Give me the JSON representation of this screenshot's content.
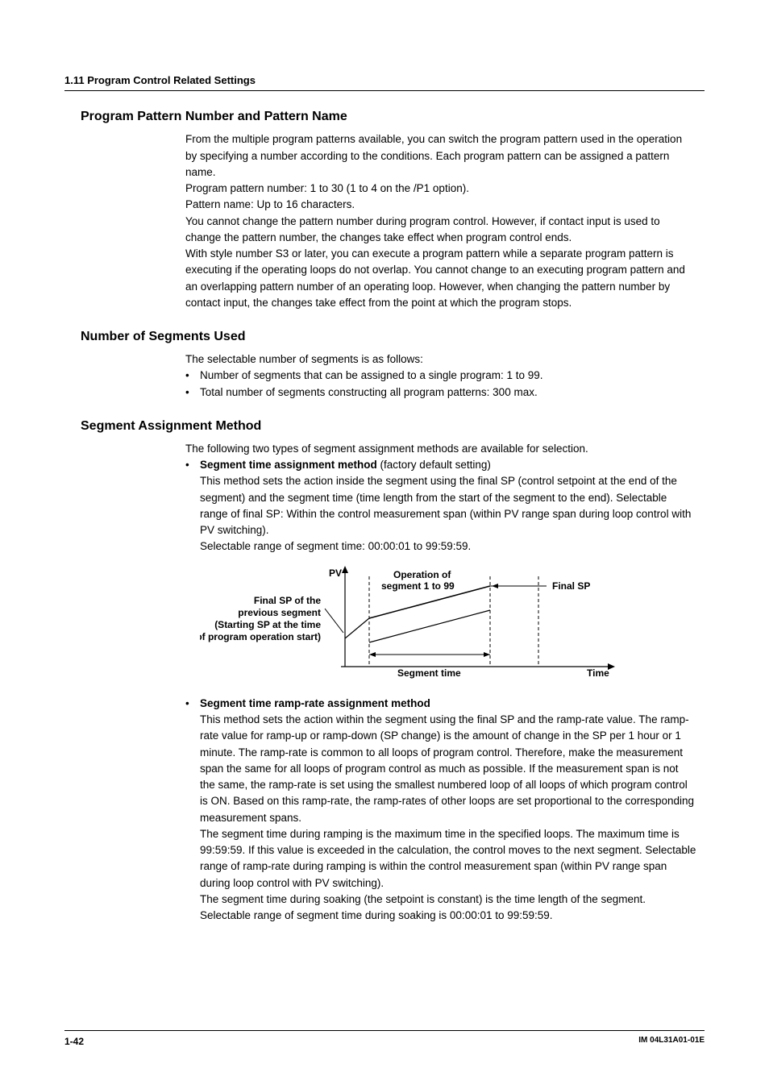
{
  "header": {
    "section": "1.11  Program Control Related Settings"
  },
  "s1": {
    "title": "Program Pattern Number and Pattern Name",
    "p1": "From the multiple program patterns available, you can switch the program pattern used in the operation by specifying a number according to the conditions.  Each program pattern can be assigned a pattern name.",
    "p2": "Program pattern number: 1 to 30 (1 to 4 on the /P1 option).",
    "p3": "Pattern name: Up to 16 characters.",
    "p4": "You cannot change the pattern number during program control.  However, if contact input is used to change the pattern number, the changes take effect when program control ends.",
    "p5": "With style number S3 or later, you can execute a program pattern while a separate program pattern is executing if the operating loops do not overlap. You cannot change to an executing program pattern and an overlapping pattern number of an operating loop. However, when changing the pattern number by contact input, the changes take effect from the point at which the program stops."
  },
  "s2": {
    "title": "Number of Segments Used",
    "p1": "The selectable number of segments is as follows:",
    "b1": "Number of segments that can be assigned to a single program: 1 to 99.",
    "b2": "Total number of segments constructing all program patterns: 300 max."
  },
  "s3": {
    "title": "Segment Assignment Method",
    "p1": "The following two types of segment assignment methods are available for selection.",
    "m1": {
      "label": "Segment time assignment method",
      "suffix": " (factory default setting)",
      "desc": "This method sets the action inside the segment using the final SP (control setpoint at the end of the segment) and the segment time (time length from the start of the segment to the end).  Selectable range of final SP: Within the control measurement span (within PV range span during loop control with PV switching).",
      "range": "Selectable range of segment time: 00:00:01 to 99:59:59."
    },
    "fig": {
      "pv": "PV",
      "opseg": "Operation of",
      "opseg2": "segment 1 to 99",
      "finalsp": "Final SP",
      "left1": "Final SP of the",
      "left2": "previous segment",
      "left3": "(Starting SP at the time",
      "left4": "of program operation start)",
      "segtime": "Segment time",
      "time": "Time"
    },
    "m2": {
      "label": "Segment time ramp-rate assignment method",
      "p1": "This method sets the action within the segment using the final SP and the ramp-rate value.  The ramp-rate value for ramp-up or ramp-down (SP change) is the amount of change in the SP per 1 hour or 1 minute.  The ramp-rate is common to all loops of program control.  Therefore, make the measurement span the same for all loops of program control as much as possible.  If the measurement span is not the same, the ramp-rate is set using the smallest numbered loop of all loops of which program control is ON.  Based on this ramp-rate, the ramp-rates of other loops are set proportional to the corresponding measurement spans.",
      "p2": "The segment time during ramping is the maximum time in the specified loops.  The maximum time is 99:59:59.  If this value is exceeded in the calculation, the control moves to the next segment.  Selectable range of ramp-rate during ramping is within the control measurement span (within PV range span during loop control with PV switching).",
      "p3": "The segment time during soaking (the setpoint is constant) is the time length of the segment.",
      "p4": "Selectable range of segment time during soaking is 00:00:01 to 99:59:59."
    }
  },
  "footer": {
    "page": "1-42",
    "docid": "IM 04L31A01-01E"
  }
}
